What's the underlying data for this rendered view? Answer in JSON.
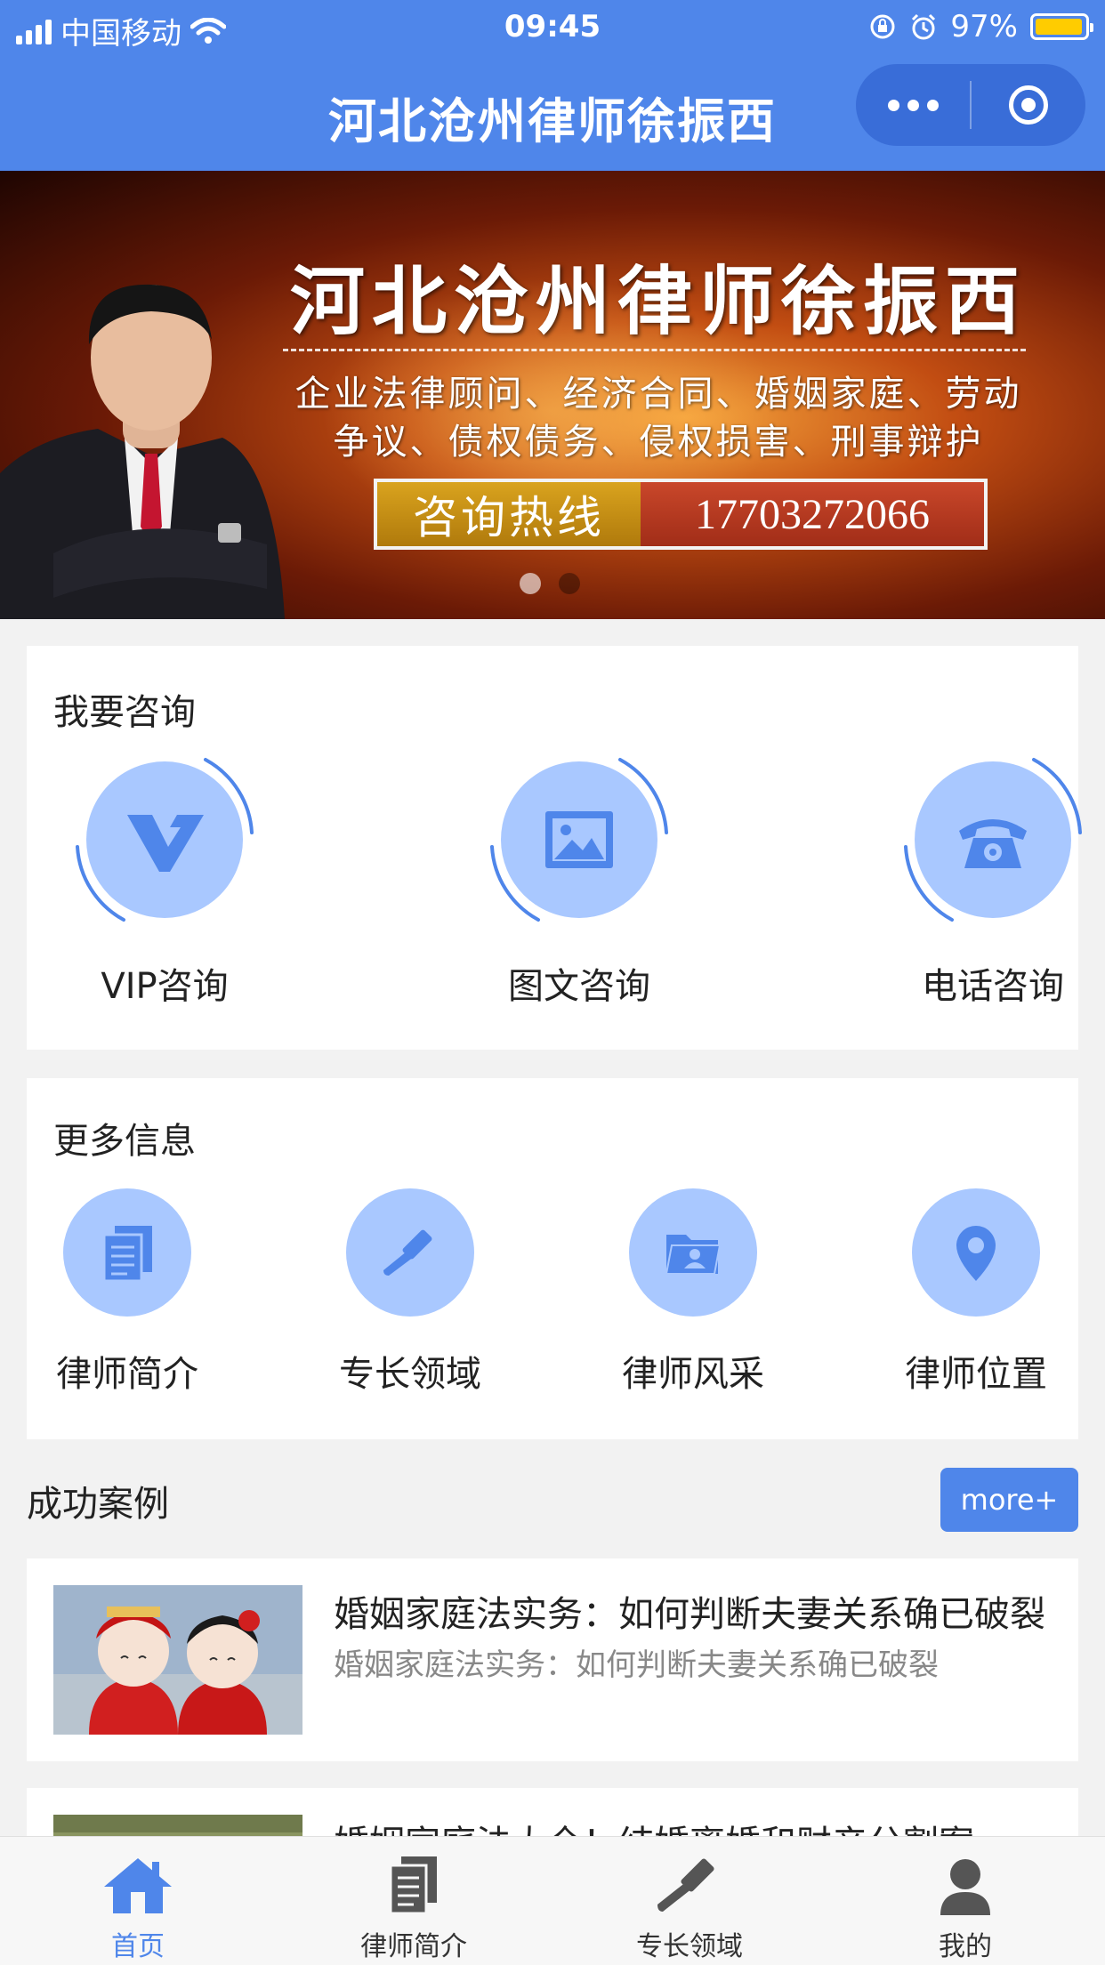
{
  "status_bar": {
    "carrier": "中国移动",
    "time": "09:45",
    "battery": "97%",
    "battery_level": 0.97
  },
  "nav": {
    "title": "河北沧州律师徐振西",
    "more_icon": "more-dots-icon",
    "close_icon": "target-close-icon"
  },
  "banner": {
    "title": "河北沧州律师徐振西",
    "subtitle_line1": "企业法律顾问、经济合同、婚姻家庭、劳动",
    "subtitle_line2": "争议、债权债务、侵权损害、刑事辩护",
    "hotline_label": "咨询热线",
    "hotline_number": "17703272066",
    "slide_count": 2,
    "active_slide": 1
  },
  "consult": {
    "title": "我要咨询",
    "items": [
      {
        "label": "VIP咨询",
        "icon": "vip-v-icon"
      },
      {
        "label": "图文咨询",
        "icon": "image-icon"
      },
      {
        "label": "电话咨询",
        "icon": "telephone-icon"
      }
    ]
  },
  "more_info": {
    "title": "更多信息",
    "items": [
      {
        "label": "律师简介",
        "icon": "document-icon"
      },
      {
        "label": "专长领域",
        "icon": "gavel-icon"
      },
      {
        "label": "律师风采",
        "icon": "folder-person-icon"
      },
      {
        "label": "律师位置",
        "icon": "location-pin-icon"
      }
    ]
  },
  "cases": {
    "title": "成功案例",
    "more_label": "more+",
    "items": [
      {
        "title": "婚姻家庭法实务：如何判断夫妻关系确已破裂",
        "desc": "婚姻家庭法实务：如何判断夫妻关系确已破裂"
      },
      {
        "title": "婚姻家庭法大全！结婚离婚和财产分割案",
        "desc": ""
      }
    ]
  },
  "tabbar": {
    "items": [
      {
        "label": "首页",
        "icon": "home-icon",
        "active": true
      },
      {
        "label": "律师简介",
        "icon": "document-icon",
        "active": false
      },
      {
        "label": "专长领域",
        "icon": "gavel-icon",
        "active": false
      },
      {
        "label": "我的",
        "icon": "user-icon",
        "active": false
      }
    ]
  },
  "colors": {
    "primary": "#4f86ea",
    "icon_bg": "#a9c8ff",
    "icon_fg": "#4f86ea",
    "page_bg": "#f2f2f2"
  }
}
